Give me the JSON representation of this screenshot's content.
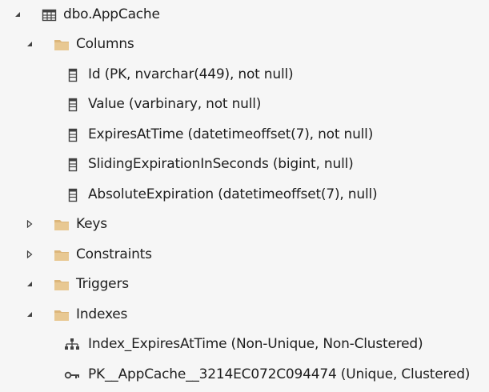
{
  "tree": {
    "table": {
      "label": "dbo.AppCache",
      "icon": "table-icon",
      "expanded": true,
      "columns_folder": {
        "label": "Columns",
        "icon": "folder-icon",
        "expanded": true,
        "items": [
          {
            "label": "Id (PK, nvarchar(449), not null)",
            "icon": "column-icon"
          },
          {
            "label": "Value (varbinary, not null)",
            "icon": "column-icon"
          },
          {
            "label": "ExpiresAtTime (datetimeoffset(7), not null)",
            "icon": "column-icon"
          },
          {
            "label": "SlidingExpirationInSeconds (bigint, null)",
            "icon": "column-icon"
          },
          {
            "label": "AbsoluteExpiration (datetimeoffset(7), null)",
            "icon": "column-icon"
          }
        ]
      },
      "keys_folder": {
        "label": "Keys",
        "icon": "folder-icon",
        "expanded": false
      },
      "constraints_folder": {
        "label": "Constraints",
        "icon": "folder-icon",
        "expanded": false
      },
      "triggers_folder": {
        "label": "Triggers",
        "icon": "folder-icon",
        "expanded": true
      },
      "indexes_folder": {
        "label": "Indexes",
        "icon": "folder-icon",
        "expanded": true,
        "items": [
          {
            "label": "Index_ExpiresAtTime (Non-Unique, Non-Clustered)",
            "icon": "index-icon"
          },
          {
            "label": "PK__AppCache__3214EC072C094474 (Unique, Clustered)",
            "icon": "primary-key-icon"
          }
        ]
      }
    }
  },
  "colors": {
    "background": "#f6f6f6",
    "text": "#1e1e1e",
    "folder": "#dcb67a",
    "icon": "#424242",
    "twisty": "#424242"
  }
}
